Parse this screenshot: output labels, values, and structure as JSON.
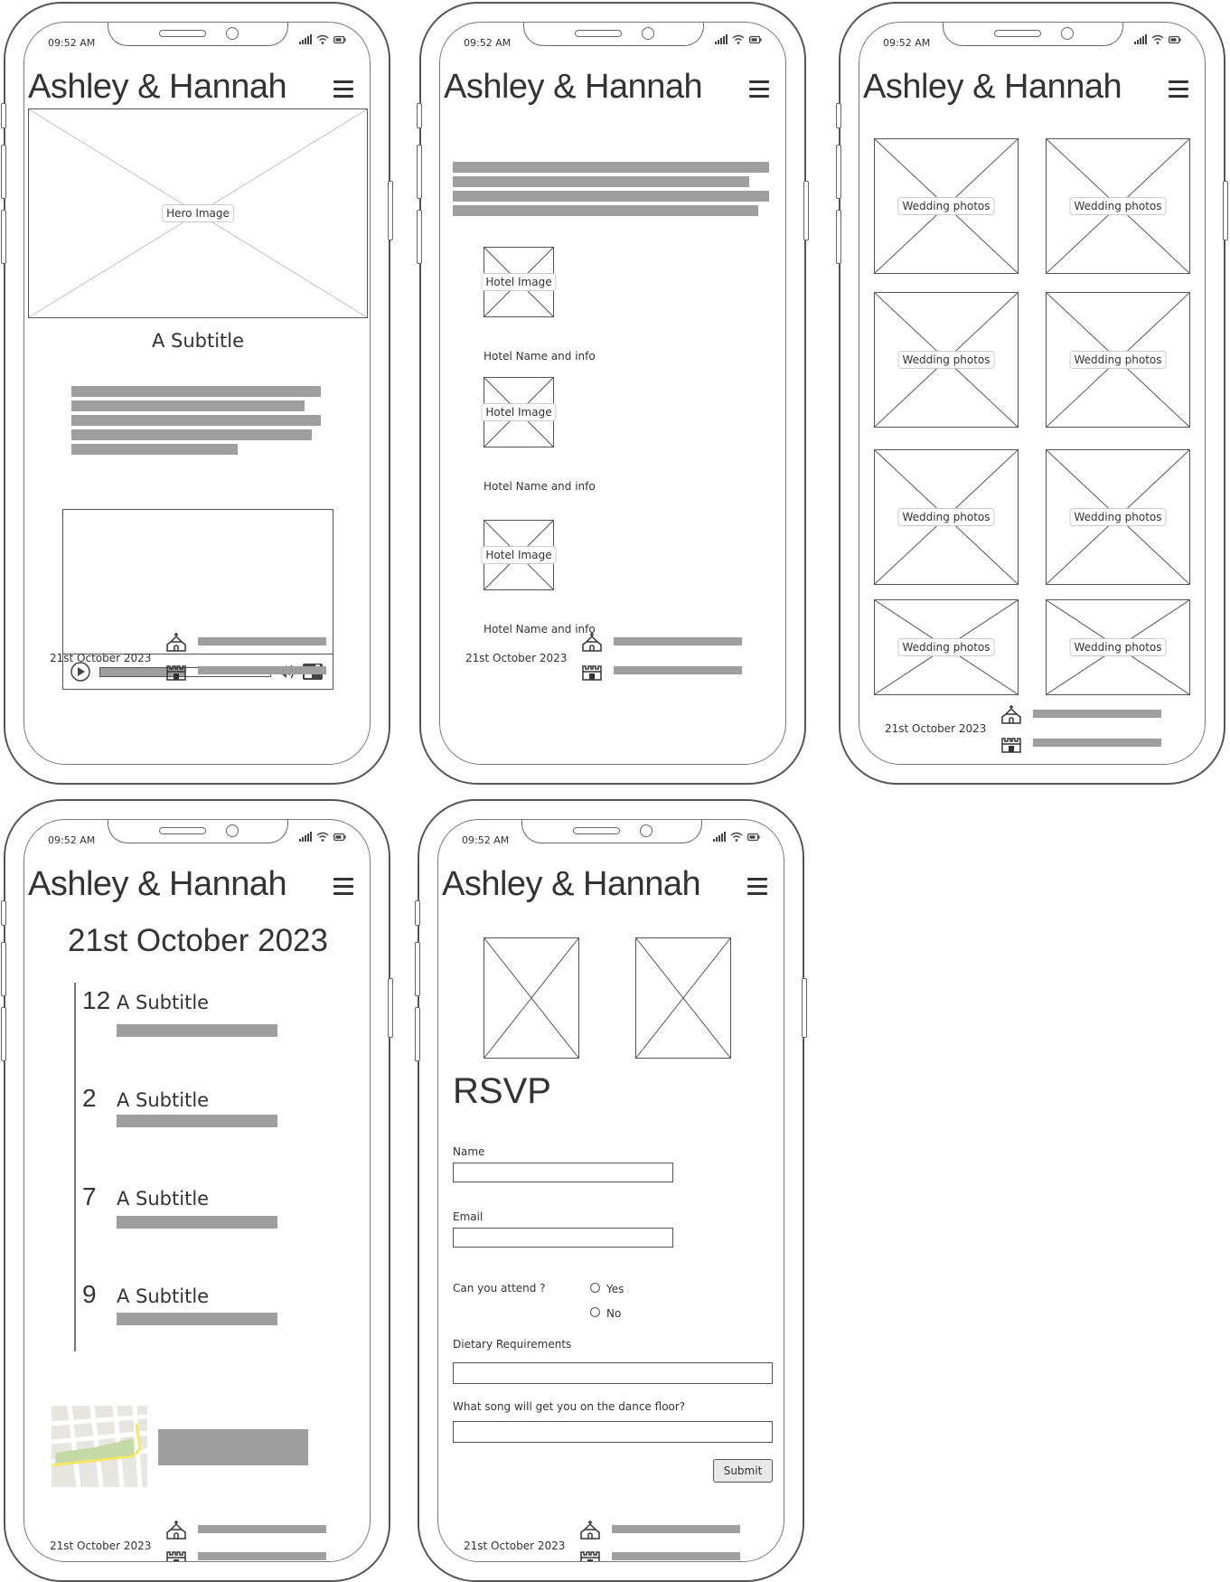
{
  "status": {
    "time": "09:52 AM"
  },
  "brand": "Ashley & Hannah",
  "footer": {
    "date": "21st October 2023"
  },
  "home": {
    "hero_label": "Hero Image",
    "subtitle": "A Subtitle"
  },
  "hotels": {
    "items": [
      {
        "image_label": "Hotel Image",
        "info": "Hotel Name and info"
      },
      {
        "image_label": "Hotel Image",
        "info": "Hotel Name and info"
      },
      {
        "image_label": "Hotel Image",
        "info": "Hotel Name and info"
      }
    ]
  },
  "gallery": {
    "photos": [
      "Wedding photos",
      "Wedding photos",
      "Wedding photos",
      "Wedding photos",
      "Wedding photos",
      "Wedding photos",
      "Wedding photos",
      "Wedding photos"
    ]
  },
  "schedule": {
    "heading": "21st October 2023",
    "items": [
      {
        "time": "12",
        "subtitle": "A Subtitle"
      },
      {
        "time": "2",
        "subtitle": "A Subtitle"
      },
      {
        "time": "7",
        "subtitle": "A Subtitle"
      },
      {
        "time": "9",
        "subtitle": "A Subtitle"
      }
    ]
  },
  "rsvp": {
    "heading": "RSVP",
    "name_label": "Name",
    "email_label": "Email",
    "attend_label": "Can you attend ?",
    "yes_label": "Yes",
    "no_label": "No",
    "dietary_label": "Dietary Requirements",
    "song_label": "What song will get you on the dance floor?",
    "submit_label": "Submit"
  }
}
